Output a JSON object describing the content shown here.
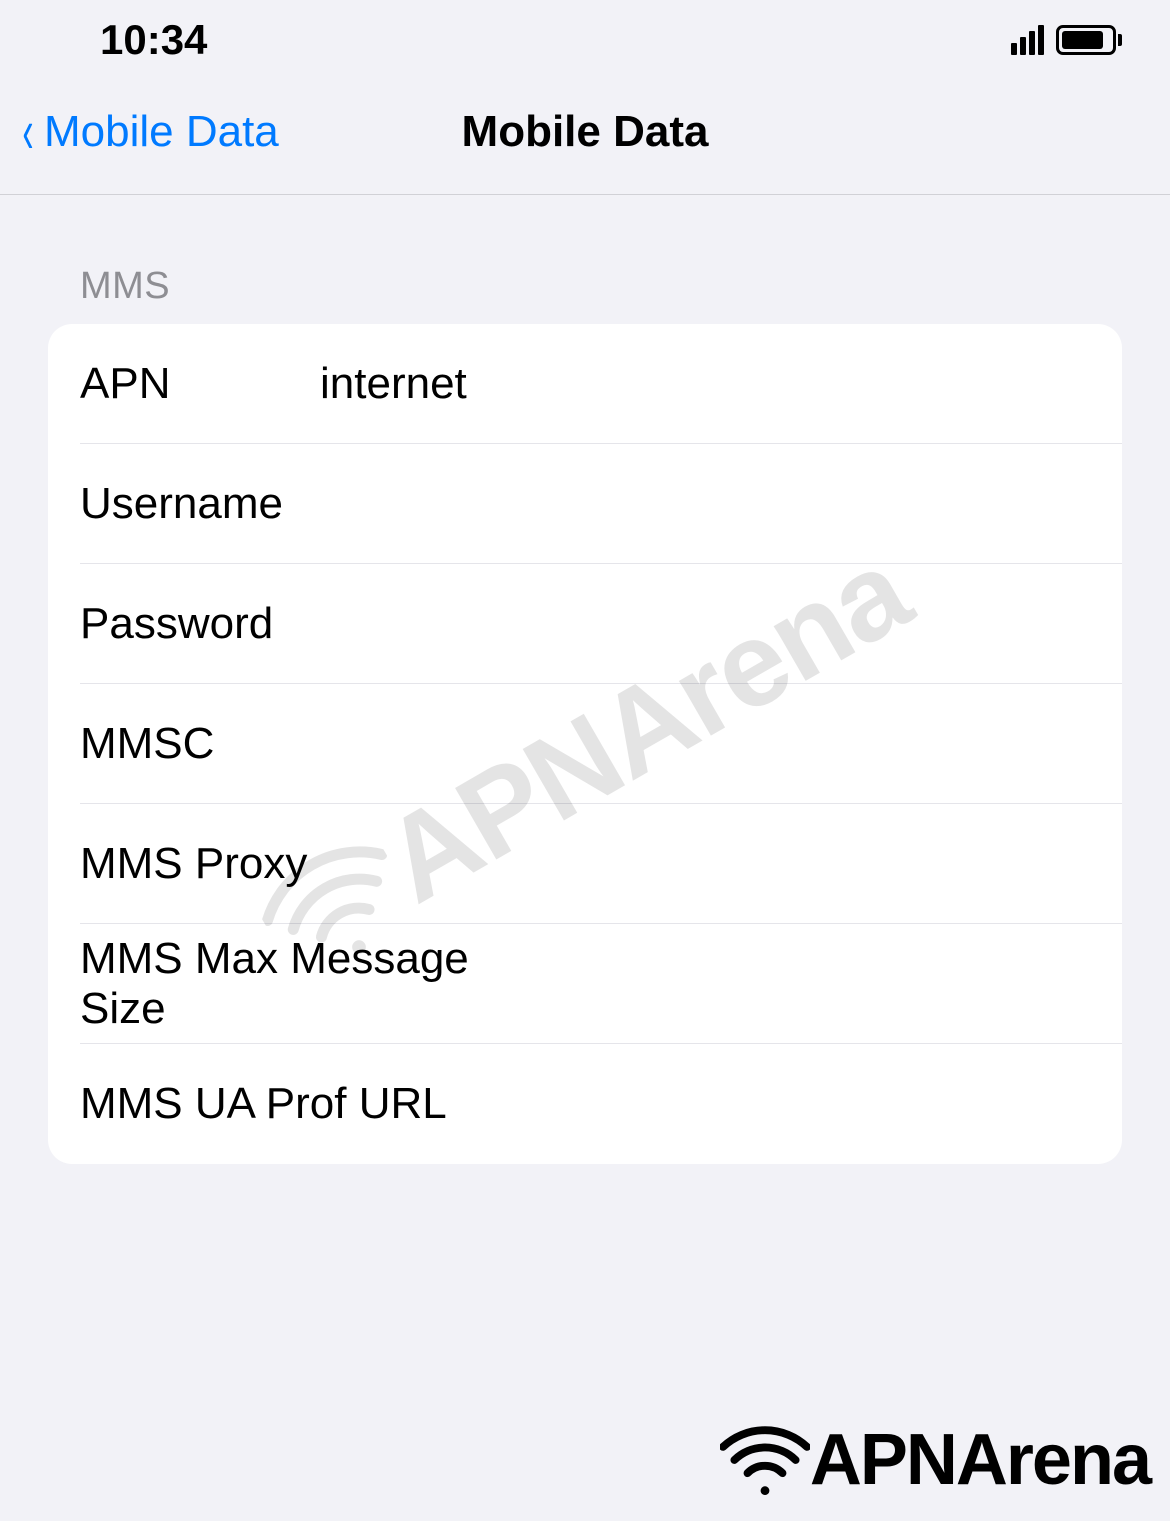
{
  "status_bar": {
    "time": "10:34"
  },
  "nav": {
    "back_label": "Mobile Data",
    "title": "Mobile Data"
  },
  "section": {
    "header": "MMS",
    "rows": [
      {
        "label": "APN",
        "value": "internet"
      },
      {
        "label": "Username",
        "value": ""
      },
      {
        "label": "Password",
        "value": ""
      },
      {
        "label": "MMSC",
        "value": ""
      },
      {
        "label": "MMS Proxy",
        "value": ""
      },
      {
        "label": "MMS Max Message Size",
        "value": ""
      },
      {
        "label": "MMS UA Prof URL",
        "value": ""
      }
    ]
  },
  "watermark": {
    "text": "APNArena"
  }
}
